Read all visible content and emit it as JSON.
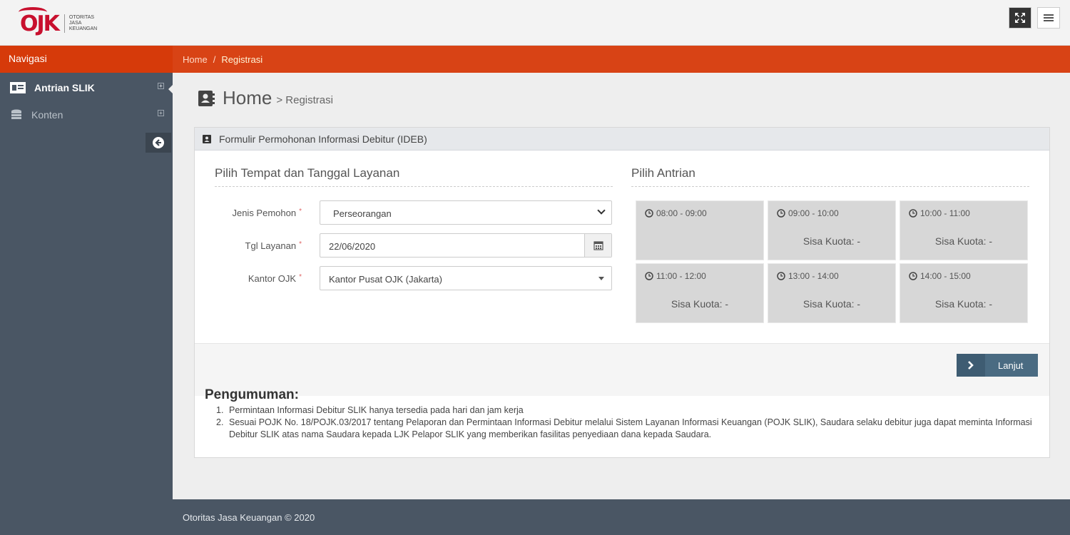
{
  "brand": {
    "logo_text": "OJK",
    "logo_subtitle": [
      "OTORITAS",
      "JASA",
      "KEUANGAN"
    ]
  },
  "nav": {
    "title": "Navigasi",
    "items": [
      {
        "label": "Antrian SLIK",
        "icon": "id-card-icon",
        "active": true
      },
      {
        "label": "Konten",
        "icon": "database-icon",
        "active": false
      }
    ]
  },
  "breadcrumb": {
    "home": "Home",
    "separator": "/",
    "current": "Registrasi"
  },
  "page": {
    "title": "Home",
    "subtitle": "> Registrasi"
  },
  "form": {
    "panel_title": "Formulir Permohonan Informasi Debitur (IDEB)",
    "left_section_title": "Pilih Tempat dan Tanggal Layanan",
    "right_section_title": "Pilih Antrian",
    "required_mark": "*",
    "fields": {
      "jenis": {
        "label": "Jenis Pemohon",
        "value": "Perseorangan"
      },
      "tanggal": {
        "label": "Tgl Layanan",
        "value": "22/06/2020"
      },
      "kantor": {
        "label": "Kantor OJK",
        "value": "Kantor Pusat OJK (Jakarta)"
      }
    },
    "slots": [
      {
        "time": "08:00 - 09:00",
        "quota": ""
      },
      {
        "time": "09:00 - 10:00",
        "quota": "Sisa Kuota: -"
      },
      {
        "time": "10:00 - 11:00",
        "quota": "Sisa Kuota: -"
      },
      {
        "time": "11:00 - 12:00",
        "quota": "Sisa Kuota: -"
      },
      {
        "time": "13:00 - 14:00",
        "quota": "Sisa Kuota: -"
      },
      {
        "time": "14:00 - 15:00",
        "quota": "Sisa Kuota: -"
      }
    ],
    "submit_label": "Lanjut"
  },
  "announcement": {
    "title": "Pengumuman:",
    "items": [
      {
        "num": "1.",
        "text": "Permintaan Informasi Debitur SLIK hanya tersedia pada hari dan jam kerja"
      },
      {
        "num": "2.",
        "text": "Sesuai POJK No. 18/POJK.03/2017 tentang Pelaporan dan Permintaan Informasi Debitur melalui Sistem Layanan Informasi Keuangan (POJK SLIK), Saudara selaku debitur juga dapat meminta Informasi Debitur SLIK atas nama Saudara kepada LJK Pelapor SLIK yang memberikan fasilitas penyediaan dana kepada Saudara."
      }
    ]
  },
  "footer": {
    "text": "Otoritas Jasa Keuangan © 2020"
  },
  "colors": {
    "brand_red": "#c8102e",
    "header_orange": "#d84315",
    "sidebar": "#4a5664",
    "button": "#4a6b82",
    "slot_bg": "#d7d7d7"
  }
}
